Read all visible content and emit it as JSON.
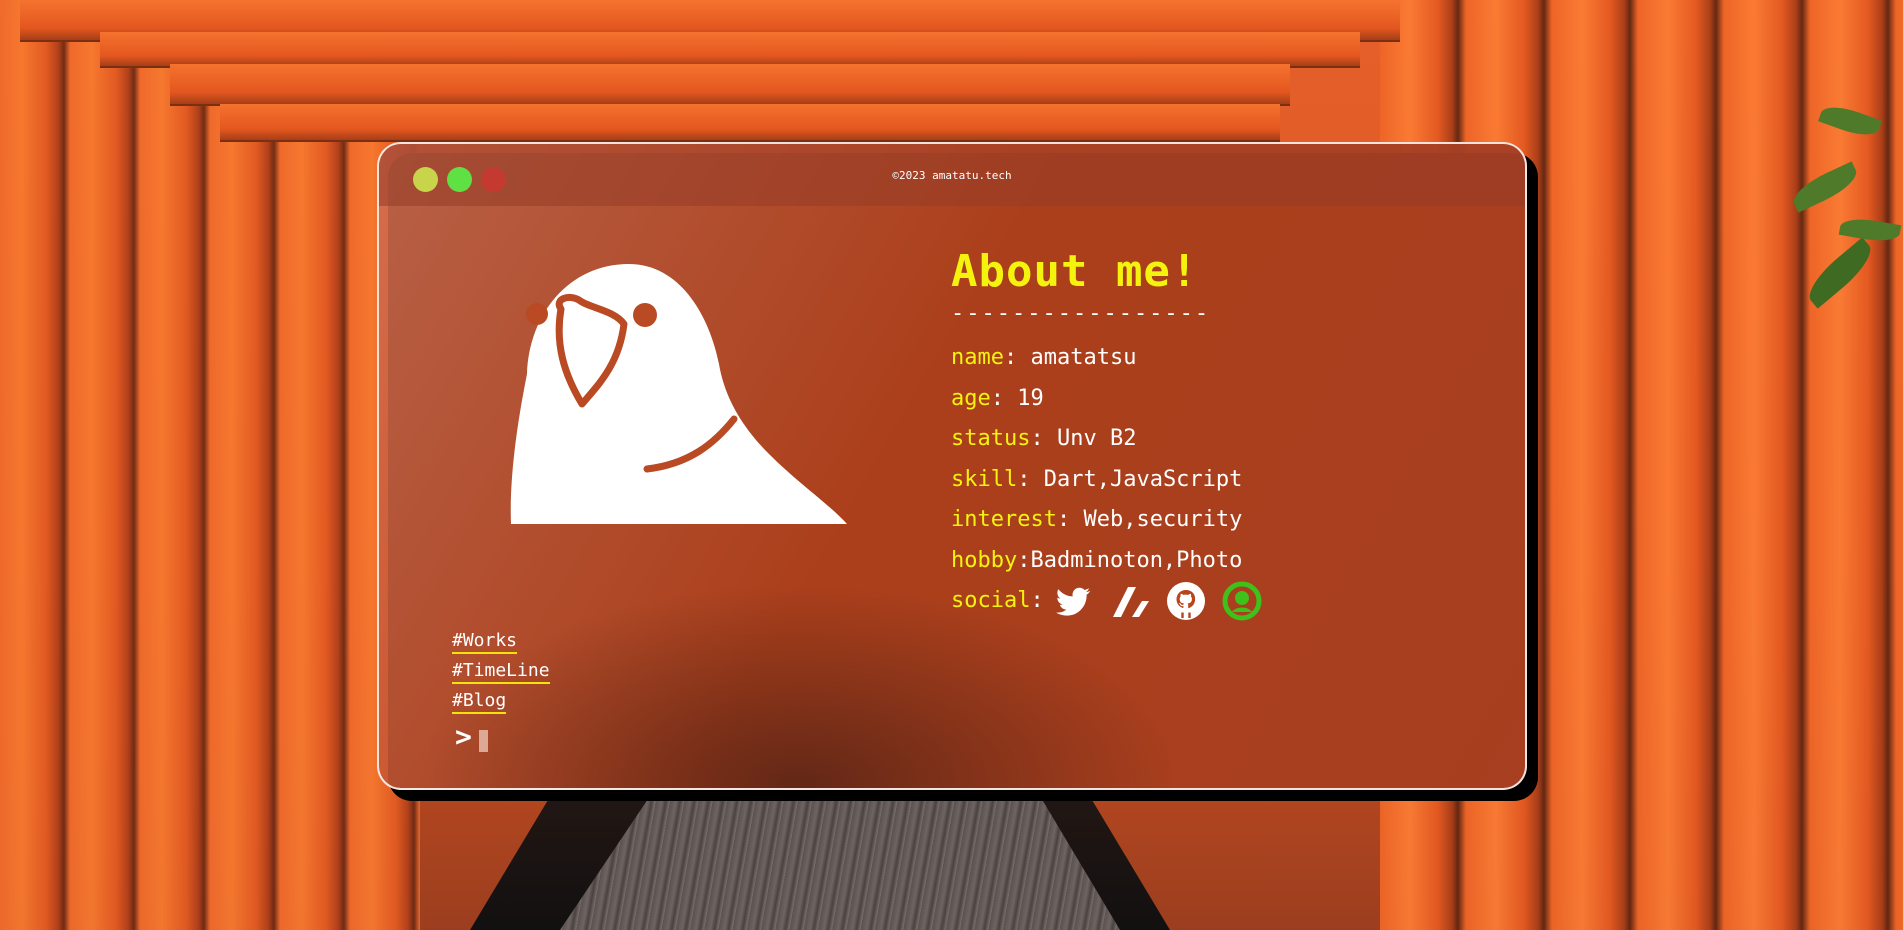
{
  "window": {
    "title": "©2023 amatatu.tech"
  },
  "nav": {
    "links": [
      "#Works",
      "#TimeLine",
      "#Blog"
    ],
    "prompt": ">"
  },
  "about": {
    "heading": "About me!",
    "divider": "-----------------",
    "fields": [
      {
        "key": "name",
        "sep": ": ",
        "value": "amatatsu"
      },
      {
        "key": "age",
        "sep": ": ",
        "value": "19"
      },
      {
        "key": "status",
        "sep": ": ",
        "value": "Unv B2"
      },
      {
        "key": "skill",
        "sep": ": ",
        "value": "Dart,JavaScript"
      },
      {
        "key": "interest",
        "sep": ": ",
        "value": "Web,security"
      },
      {
        "key": "hobby",
        "sep": ":",
        "value": "Badminoton,Photo"
      }
    ],
    "social_label": "social",
    "social_sep": ":",
    "social_icons": [
      "twitter-icon",
      "zenn-icon",
      "github-icon",
      "misskey-icon"
    ]
  },
  "colors": {
    "accent_yellow": "#f4f30e",
    "window_dot_yellow": "#c8d44a",
    "window_dot_green": "#5fe043",
    "window_dot_red": "#c43a31",
    "social_green": "#3fc01a"
  }
}
